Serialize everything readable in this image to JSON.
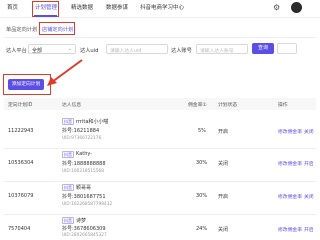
{
  "nav": {
    "items": [
      {
        "label": "首页"
      },
      {
        "label": "计划管理"
      },
      {
        "label": "精选数据"
      },
      {
        "label": "数据参谋"
      },
      {
        "label": "抖音电商学习中心"
      }
    ],
    "active_index": 1
  },
  "subtabs": {
    "items": [
      {
        "label": "单品定向计划"
      },
      {
        "label": "店铺定向计划"
      }
    ],
    "active_index": 1
  },
  "filter": {
    "platform_label": "达人平台",
    "platform_value": "全部",
    "uid_label": "达人uid",
    "uid_placeholder": "请输入达人uid",
    "account_label": "达人账号",
    "account_placeholder": "请输入达人账号",
    "search_label": "查询"
  },
  "add_button_label": "添加定向计划",
  "table": {
    "headers": [
      "定向计划ID",
      "达人信息",
      "佣金率①",
      "计划状态",
      "操作"
    ],
    "rows": [
      {
        "id": "11222943",
        "tag": "抖音",
        "name": "rrrita和小小喵",
        "account": "抖号:16211884",
        "uid": "UID:97366722176",
        "commission": "5%",
        "status": "开启",
        "action_edit": "修改佣金率",
        "action_toggle": "关闭"
      },
      {
        "id": "10536304",
        "tag": "抖音",
        "name": "Kathy-",
        "account": "抖号:1888888888",
        "uid": "UID:100218515568",
        "commission": "30%",
        "status": "关闭",
        "action_edit": "修改佣金率",
        "action_toggle": "开启"
      },
      {
        "id": "10376079",
        "tag": "抖音",
        "name": "颖哥哥",
        "account": "抖号:3801687751",
        "uid": "UID:102268587798432",
        "commission": "30%",
        "status": "开启",
        "action_edit": "修改佣金率",
        "action_toggle": "关闭"
      },
      {
        "id": "7570404",
        "tag": "抖音",
        "name": "诗梦",
        "account": "抖号:3678606309",
        "uid": "UID:2802665845327",
        "commission": "24%",
        "status": "关闭",
        "action_edit": "修改佣金率",
        "action_toggle": "开启"
      }
    ]
  },
  "colors": {
    "accent": "#5b4ee6",
    "highlight": "#e03b2a"
  },
  "icons": {
    "settings": "gear-icon",
    "profile": "avatar"
  }
}
